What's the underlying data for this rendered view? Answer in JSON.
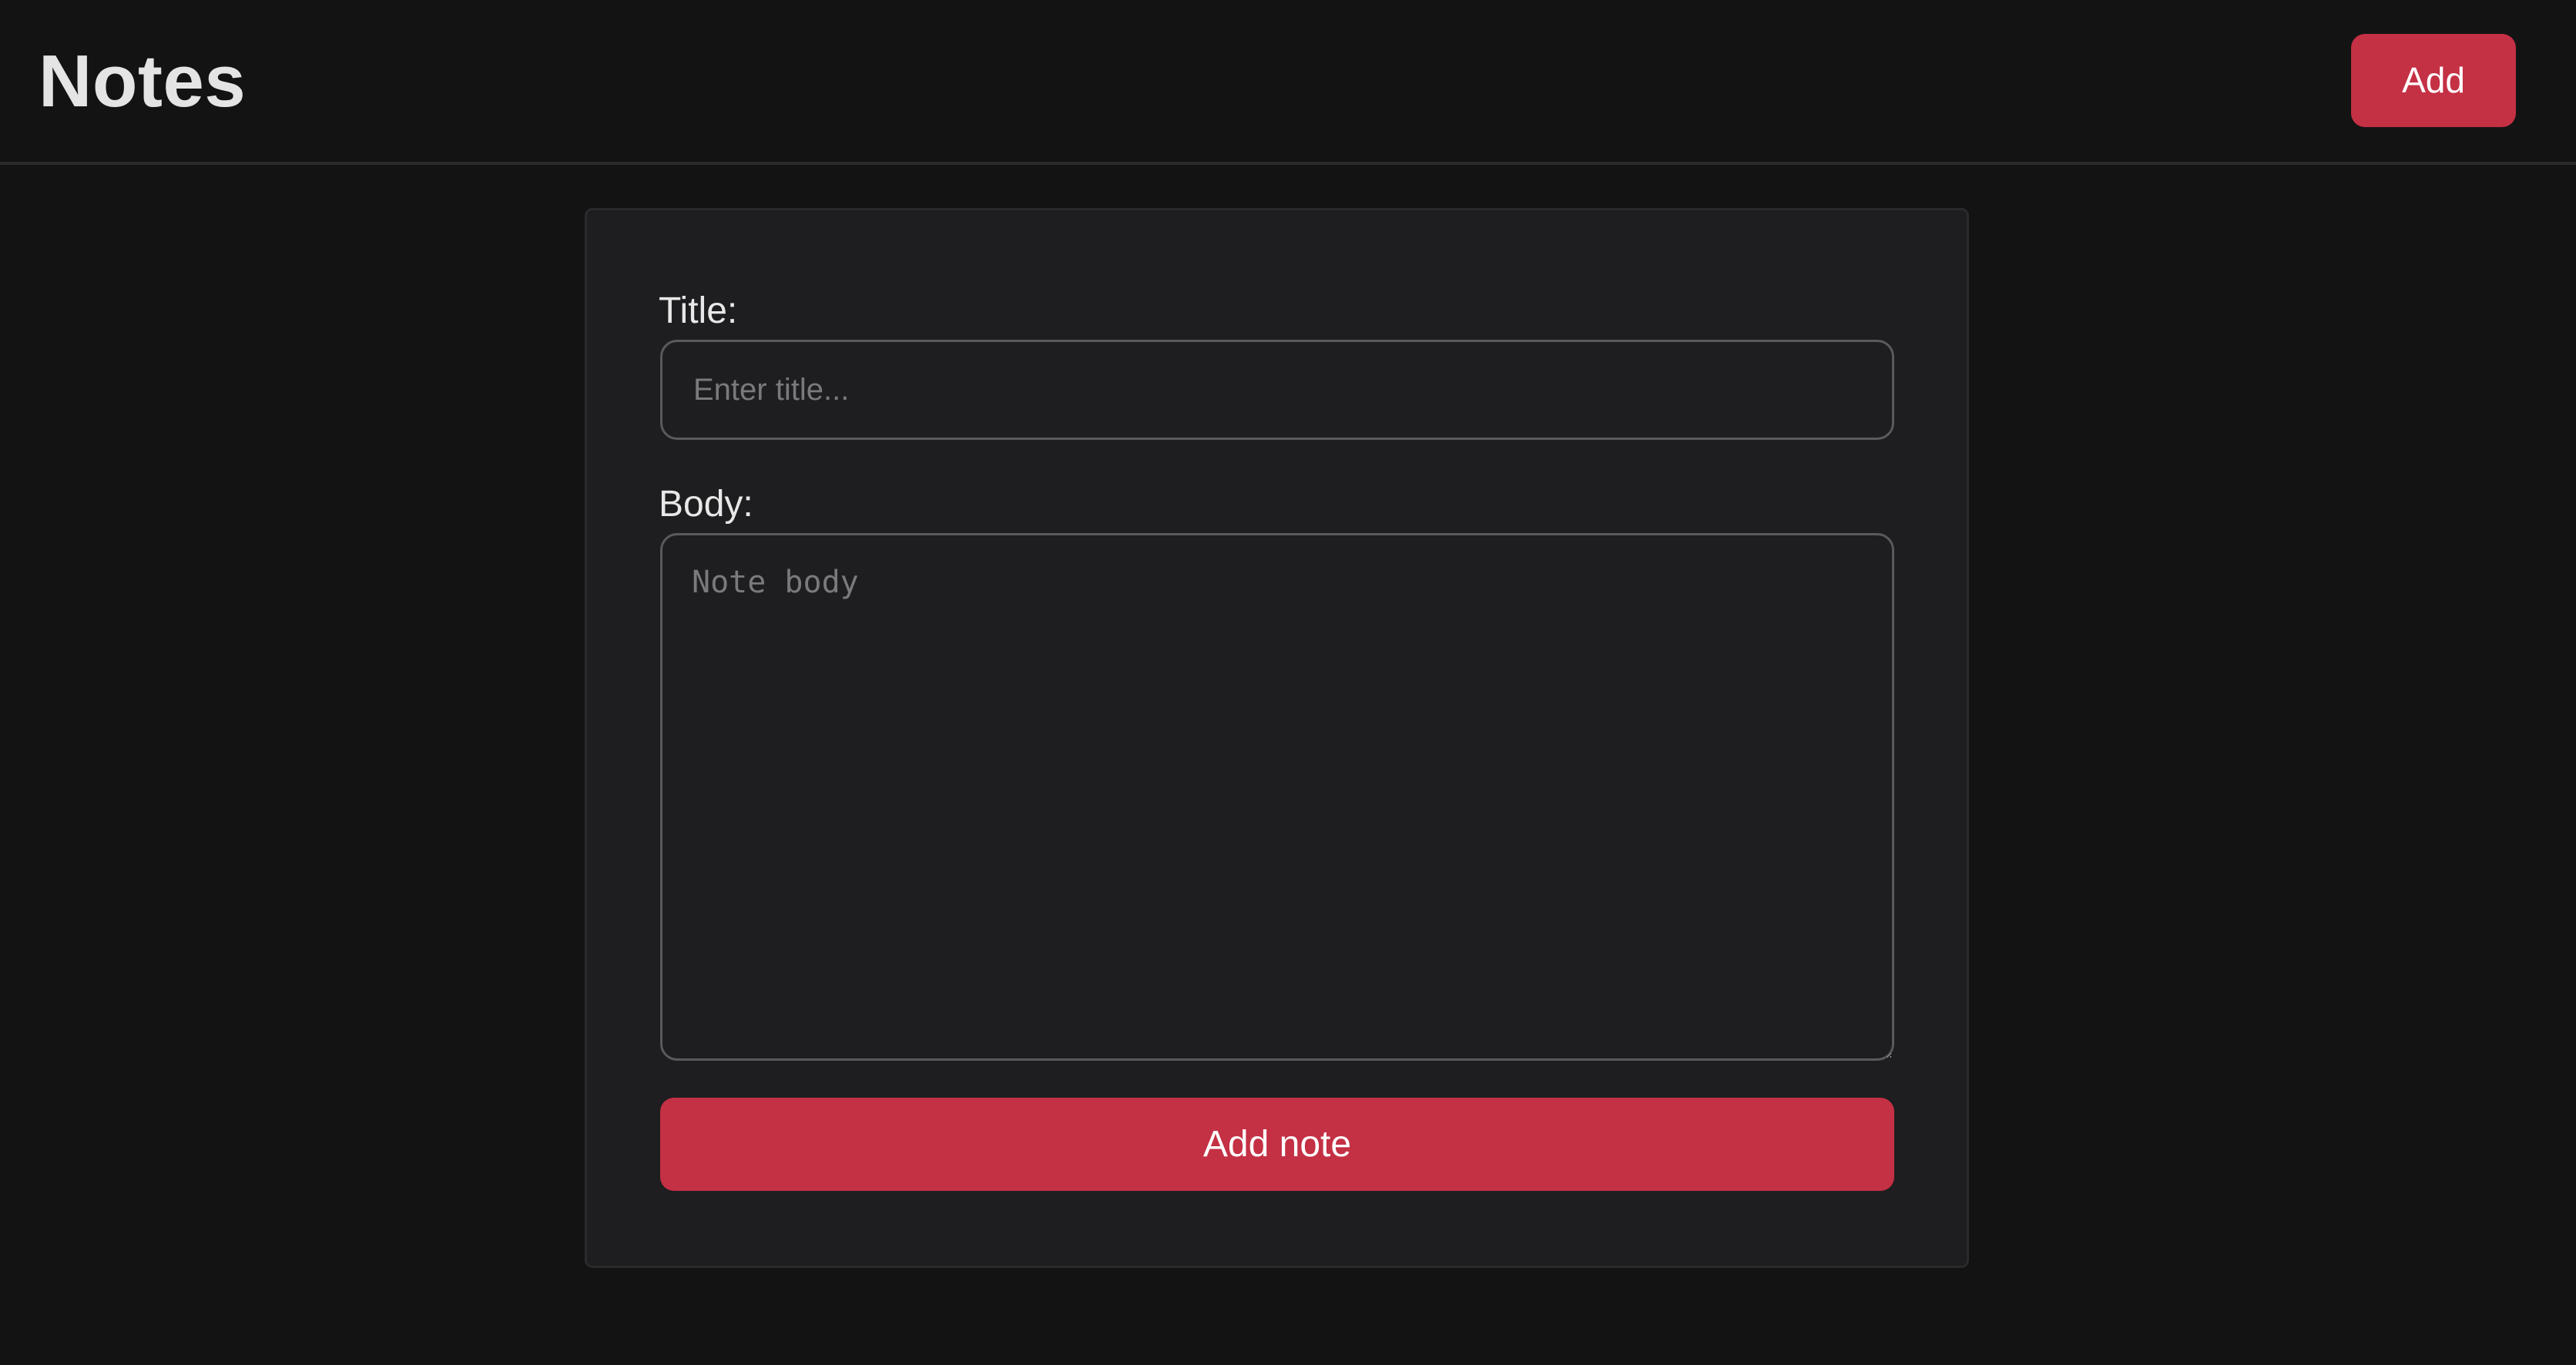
{
  "header": {
    "title": "Notes",
    "add_button_label": "Add"
  },
  "form": {
    "title_label": "Title:",
    "title_placeholder": "Enter title...",
    "title_value": "",
    "body_label": "Body:",
    "body_placeholder": "Note body",
    "body_value": "",
    "submit_label": "Add note"
  },
  "colors": {
    "background": "#131314",
    "card": "#1e1e20",
    "accent": "#c43044",
    "text": "#e4e4e4",
    "placeholder": "#7a7a7c"
  }
}
